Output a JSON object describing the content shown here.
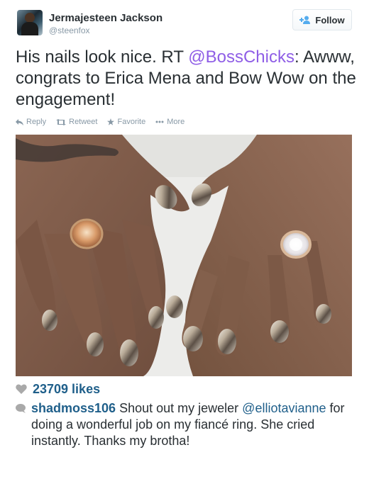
{
  "author": {
    "name": "Jermajesteen Jackson",
    "handle": "@steenfox",
    "follow_label": "Follow"
  },
  "tweet": {
    "text_before": "His nails look nice. RT ",
    "mention": "@BossChicks",
    "text_after": ": Awww, congrats to Erica Mena and Bow Wow on the engagement!"
  },
  "actions": {
    "reply": "Reply",
    "retweet": "Retweet",
    "favorite": "Favorite",
    "more": "More"
  },
  "instagram": {
    "likes": "23709 likes",
    "comment_user": "shadmoss106",
    "comment_text_1": " Shout out my jeweler ",
    "comment_mention": "@elliotavianne",
    "comment_text_2": " for doing a wonderful job on my fiancé ring. She cried instantly. Thanks my brotha!"
  },
  "colors": {
    "accent_link": "#8f5ee6",
    "instagram_blue": "#1f5f8a",
    "muted": "#8899a6"
  },
  "icons": [
    "user-plus-icon",
    "reply-icon",
    "retweet-icon",
    "star-icon",
    "ellipsis-icon",
    "heart-icon",
    "speech-bubble-icon"
  ]
}
